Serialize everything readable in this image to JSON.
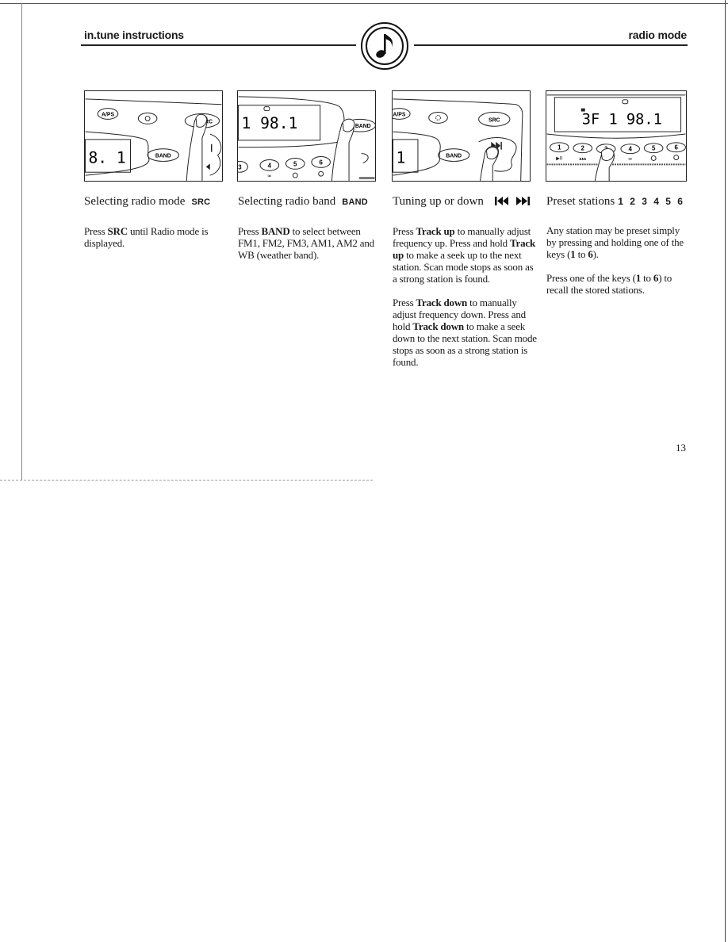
{
  "header": {
    "left_title": "in.tune instructions",
    "right_title": "radio mode",
    "logo_icon": "music-note-icon"
  },
  "sections": [
    {
      "heading": "Selecting radio mode",
      "tag": "SRC",
      "illustration": {
        "buttons": [
          "A/PS",
          "SRC",
          "BAND"
        ],
        "display": "8. 1"
      },
      "paragraphs": [
        [
          {
            "t": "Press "
          },
          {
            "t": "SRC",
            "b": true
          },
          {
            "t": " until Radio mode is displayed."
          }
        ]
      ]
    },
    {
      "heading": "Selecting radio band",
      "tag": "BAND",
      "illustration": {
        "buttons": [
          "BAND",
          "3",
          "4",
          "5",
          "6"
        ],
        "display": "1   98.1"
      },
      "paragraphs": [
        [
          {
            "t": "Press "
          },
          {
            "t": "BAND",
            "b": true
          },
          {
            "t": " to select between FM1, FM2, FM3, AM1, AM2 and WB (weather band)."
          }
        ]
      ]
    },
    {
      "heading": "Tuning up or down",
      "tag_icons": [
        "track-previous-icon",
        "track-next-icon"
      ],
      "illustration": {
        "buttons": [
          "A/PS",
          "SRC",
          "BAND"
        ],
        "display": "1"
      },
      "paragraphs": [
        [
          {
            "t": "Press "
          },
          {
            "t": "Track up",
            "b": true
          },
          {
            "t": " to manually adjust frequency up. Press and hold "
          },
          {
            "t": "Track up",
            "b": true
          },
          {
            "t": " to make a seek up to the next station. Scan mode stops as soon as a strong station is found."
          }
        ],
        [
          {
            "t": "Press "
          },
          {
            "t": "Track down",
            "b": true
          },
          {
            "t": " to manually adjust frequency down. Press and hold "
          },
          {
            "t": "Track down",
            "b": true
          },
          {
            "t": " to make a seek down to the next station. Scan mode stops as soon as a strong station is found."
          }
        ]
      ]
    },
    {
      "heading": "Preset stations",
      "tag": "1 2 3 4 5 6",
      "illustration": {
        "buttons": [
          "1",
          "2",
          "3",
          "4",
          "5",
          "6"
        ],
        "display": "3F 1   98.1"
      },
      "paragraphs": [
        [
          {
            "t": "Any station may be preset simply by pressing and holding one of the keys ("
          },
          {
            "t": "1",
            "b": true
          },
          {
            "t": " to "
          },
          {
            "t": "6",
            "b": true
          },
          {
            "t": ")."
          }
        ],
        [
          {
            "t": "Press one of the keys ("
          },
          {
            "t": "1",
            "b": true
          },
          {
            "t": " to "
          },
          {
            "t": "6",
            "b": true
          },
          {
            "t": ") to recall the stored stations."
          }
        ]
      ]
    }
  ],
  "page_number": "13"
}
